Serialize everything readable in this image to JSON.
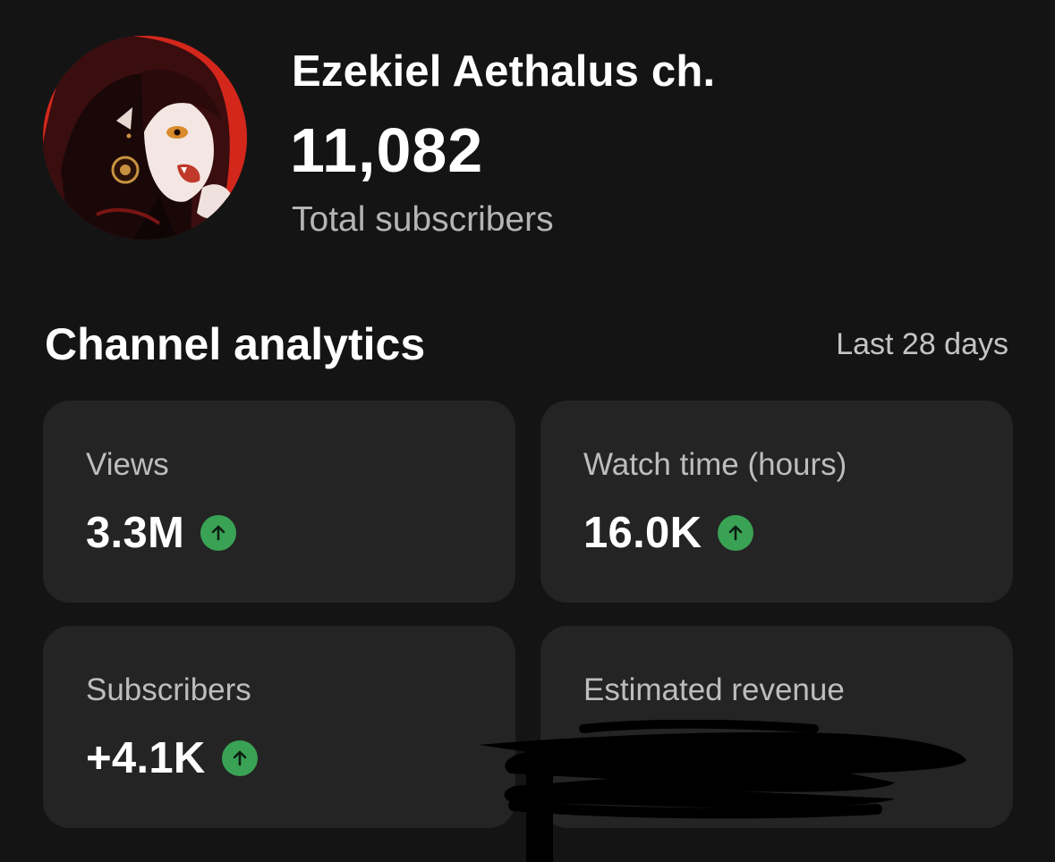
{
  "channel": {
    "name": "Ezekiel Aethalus ch.",
    "subscriber_count": "11,082",
    "subscriber_label": "Total subscribers"
  },
  "analytics": {
    "title": "Channel analytics",
    "period": "Last 28 days",
    "cards": [
      {
        "label": "Views",
        "value": "3.3M",
        "trend": "up",
        "trend_icon": "arrow-up-icon"
      },
      {
        "label": "Watch time (hours)",
        "value": "16.0K",
        "trend": "up",
        "trend_icon": "arrow-up-icon"
      },
      {
        "label": "Subscribers",
        "value": "+4.1K",
        "trend": "up",
        "trend_icon": "arrow-up-icon"
      },
      {
        "label": "Estimated revenue",
        "value": "",
        "redacted": true
      }
    ]
  },
  "colors": {
    "background": "#141414",
    "card": "#242424",
    "trend_up": "#3aa255",
    "avatar_bg": "#d3271c"
  }
}
